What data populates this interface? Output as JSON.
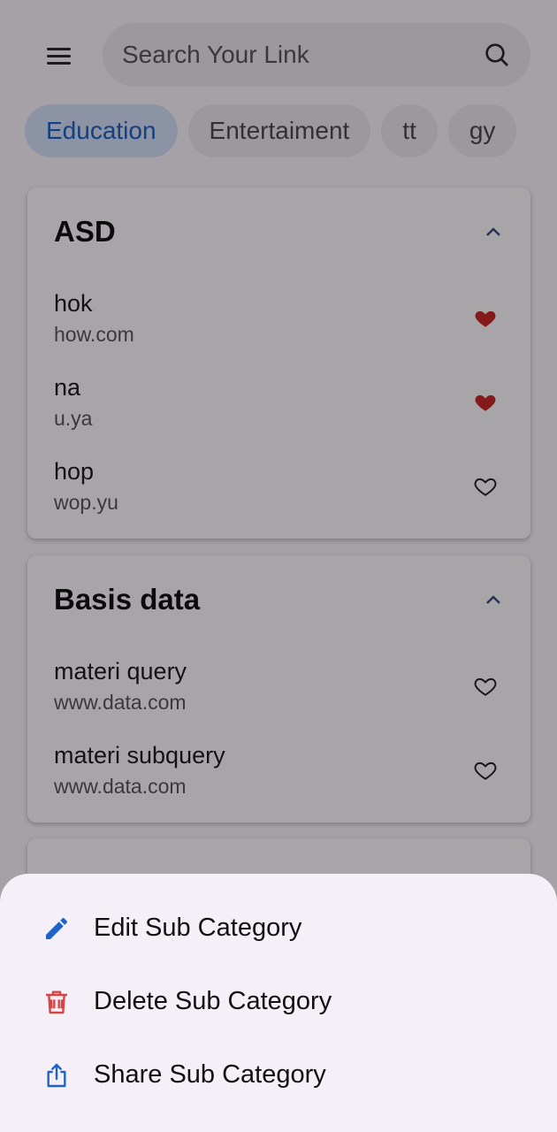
{
  "search": {
    "placeholder": "Search Your Link"
  },
  "chips": [
    {
      "label": "Education",
      "active": true
    },
    {
      "label": "Entertaiment",
      "active": false
    },
    {
      "label": "tt",
      "active": false
    },
    {
      "label": "gy",
      "active": false
    }
  ],
  "cards": [
    {
      "title": "ASD",
      "links": [
        {
          "name": "hok",
          "url": "how.com",
          "favorite": true
        },
        {
          "name": "na",
          "url": "u.ya",
          "favorite": true
        },
        {
          "name": "hop",
          "url": "wop.yu",
          "favorite": false
        }
      ]
    },
    {
      "title": "Basis data",
      "links": [
        {
          "name": "materi query",
          "url": "www.data.com",
          "favorite": false
        },
        {
          "name": "materi subquery",
          "url": "www.data.com",
          "favorite": false
        }
      ]
    }
  ],
  "sheet": {
    "edit_label": "Edit Sub Category",
    "delete_label": "Delete Sub Category",
    "share_label": "Share Sub Category"
  },
  "colors": {
    "accent": "#1f5fbf",
    "heart_filled": "#c62828",
    "delete_icon": "#d84343",
    "edit_icon": "#1e63c9"
  }
}
